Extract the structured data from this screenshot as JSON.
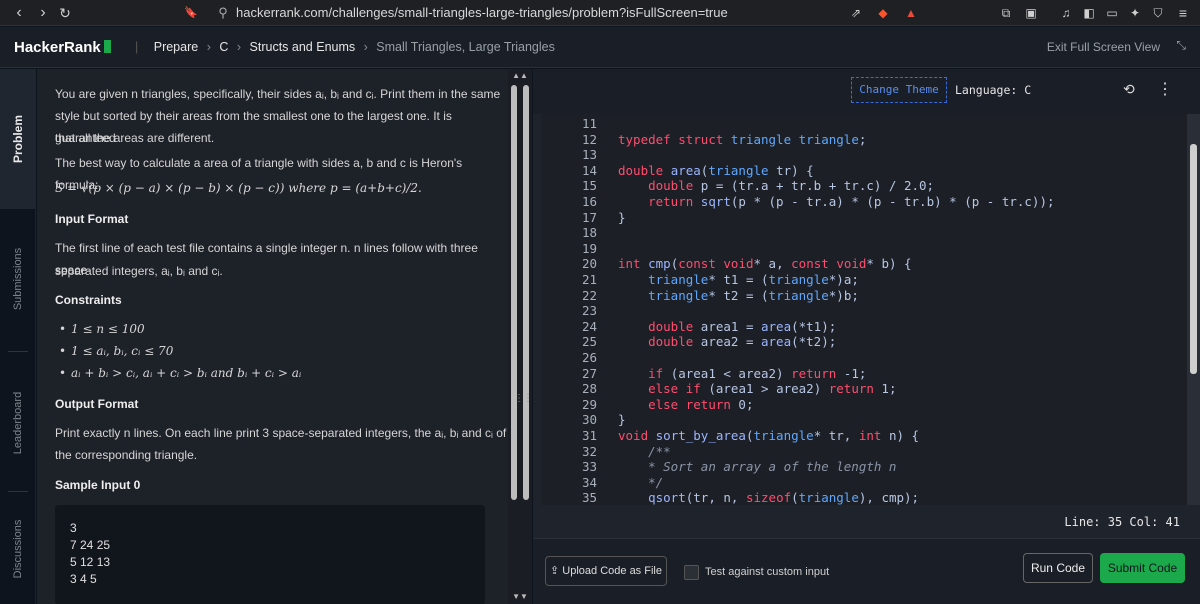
{
  "browser": {
    "url": "hackerrank.com/challenges/small-triangles-large-triangles/problem?isFullScreen=true",
    "back_icon": "‹",
    "forward_icon": "›",
    "reload_icon": "↻",
    "bookmark_icon": "🔖"
  },
  "header": {
    "logo": "HackerRank",
    "crumb_prepare": "Prepare",
    "crumb_c": "C",
    "crumb_structs": "Structs and Enums",
    "crumb_current": "Small Triangles, Large Triangles",
    "exit_fullscreen": "Exit Full Screen View"
  },
  "side_tabs": {
    "problem": "Problem",
    "submissions": "Submissions",
    "leaderboard": "Leaderboard",
    "discussions": "Discussions"
  },
  "problem": {
    "p1a": "You are given n triangles, specifically, their sides aᵢ, bᵢ and cᵢ. Print them in the same",
    "p1b": "style but sorted by their areas from the smallest one to the largest one. It is guaranteed",
    "p1c": "that all the areas are different.",
    "p2": "The best way to calculate a area of a triangle with sides a, b and c is Heron's formula:",
    "formula": "S = √(p × (p − a) × (p − b) × (p − c))  where p = (a+b+c)/2.",
    "input_heading": "Input Format",
    "input_a": "The first line of each test file contains a single integer n. n lines follow with three space-",
    "input_b": "separated integers, aᵢ, bᵢ and cᵢ.",
    "constraints_heading": "Constraints",
    "constraints": [
      "1 ≤ n ≤ 100",
      "1 ≤ aᵢ, bᵢ, cᵢ ≤ 70",
      "aᵢ + bᵢ > cᵢ, aᵢ + cᵢ > bᵢ and bᵢ + cᵢ > aᵢ"
    ],
    "output_heading": "Output Format",
    "output_a": "Print exactly n lines. On each line print 3 space-separated integers, the aᵢ, bᵢ and cᵢ of",
    "output_b": "the corresponding triangle.",
    "sample_heading": "Sample Input 0",
    "sample_lines": [
      "3",
      "7 24 25",
      "5 12 13",
      "3 4 5"
    ]
  },
  "editor": {
    "change_theme": "Change Theme",
    "language": "Language: C",
    "line_info": "Line: 35 Col: 41",
    "upload": "Upload Code as File",
    "custom_input": "Test against custom input",
    "run": "Run Code",
    "submit": "Submit Code",
    "code_lines": [
      {
        "n": "11",
        "html": ""
      },
      {
        "n": "12",
        "html": "<span class='kw'>typedef</span> <span class='kw'>struct</span> <span class='ty'>triangle</span> <span class='ty'>triangle</span>;"
      },
      {
        "n": "13",
        "html": ""
      },
      {
        "n": "14",
        "html": "<span class='kw'>double</span> <span class='fn'>area</span>(<span class='ty'>triangle</span> tr) {"
      },
      {
        "n": "15",
        "html": "    <span class='kw'>double</span> p = (tr.a + tr.b + tr.c) / 2.0;"
      },
      {
        "n": "16",
        "html": "    <span class='kw'>return</span> <span class='fn'>sqrt</span>(p * (p - tr.a) * (p - tr.b) * (p - tr.c));"
      },
      {
        "n": "17",
        "html": "}"
      },
      {
        "n": "18",
        "html": ""
      },
      {
        "n": "19",
        "html": ""
      },
      {
        "n": "20",
        "html": "<span class='kw'>int</span> <span class='fn'>cmp</span>(<span class='kw'>const</span> <span class='kw'>void</span>* a, <span class='kw'>const</span> <span class='kw'>void</span>* b) {"
      },
      {
        "n": "21",
        "html": "    <span class='ty'>triangle</span>* t1 = (<span class='ty'>triangle</span>*)a;"
      },
      {
        "n": "22",
        "html": "    <span class='ty'>triangle</span>* t2 = (<span class='ty'>triangle</span>*)b;"
      },
      {
        "n": "23",
        "html": ""
      },
      {
        "n": "24",
        "html": "    <span class='kw'>double</span> area1 = <span class='fn'>area</span>(*t1);"
      },
      {
        "n": "25",
        "html": "    <span class='kw'>double</span> area2 = <span class='fn'>area</span>(*t2);"
      },
      {
        "n": "26",
        "html": ""
      },
      {
        "n": "27",
        "html": "    <span class='kw'>if</span> (area1 &lt; area2) <span class='kw'>return</span> -1;"
      },
      {
        "n": "28",
        "html": "    <span class='kw'>else</span> <span class='kw'>if</span> (area1 &gt; area2) <span class='kw'>return</span> 1;"
      },
      {
        "n": "29",
        "html": "    <span class='kw'>else</span> <span class='kw'>return</span> 0;"
      },
      {
        "n": "30",
        "html": "}"
      },
      {
        "n": "31",
        "html": "<span class='kw'>void</span> <span class='fn'>sort_by_area</span>(<span class='ty'>triangle</span>* tr, <span class='kw'>int</span> n) {"
      },
      {
        "n": "32",
        "html": "    <span class='cm'>/**</span>"
      },
      {
        "n": "33",
        "html": "    <span class='cm'>* Sort an array a of the length n</span>"
      },
      {
        "n": "34",
        "html": "    <span class='cm'>*/</span>"
      },
      {
        "n": "35",
        "html": "    <span class='fn'>qsort</span>(tr, n, <span class='kw'>sizeof</span>(<span class='ty'>triangle</span>), cmp);"
      }
    ]
  }
}
